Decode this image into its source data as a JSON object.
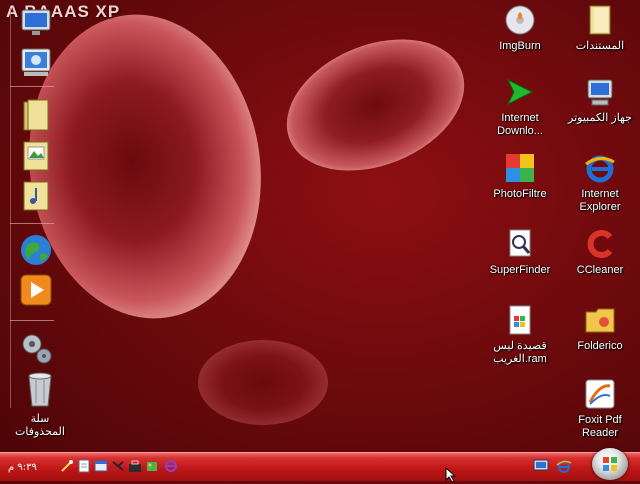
{
  "desktop": {
    "brand": "A    BAAAS XP",
    "recycle_bin": {
      "label": "سلة المحذوفات",
      "icon": "recycle-bin-icon"
    },
    "icons": [
      {
        "label": "المستندات",
        "icon": "my-documents-folder-icon"
      },
      {
        "label": "ImgBurn",
        "icon": "imgburn-disc-icon"
      },
      {
        "label": "جهاز الكمبيوتر",
        "icon": "my-computer-icon"
      },
      {
        "label": "Internet\nDownlo...",
        "icon": "internet-download-manager-icon"
      },
      {
        "label": "Internet\nExplorer",
        "icon": "internet-explorer-icon"
      },
      {
        "label": "PhotoFiltre",
        "icon": "photofiltre-icon"
      },
      {
        "label": "CCleaner",
        "icon": "ccleaner-icon"
      },
      {
        "label": "SuperFinder",
        "icon": "superfinder-icon"
      },
      {
        "label": "Folderico",
        "icon": "folderico-icon"
      },
      {
        "label": "قصيدة ليس\nالغريب.ram",
        "icon": "ram-media-file-icon"
      },
      {
        "label": "Foxit Pdf\nReader",
        "icon": "foxit-reader-icon"
      }
    ]
  },
  "sidebar": {
    "items": [
      {
        "icon": "computer-monitor-icon"
      },
      {
        "icon": "control-panel-icon"
      },
      {
        "icon": "folder-icon"
      },
      {
        "icon": "pictures-folder-icon"
      },
      {
        "icon": "music-folder-icon"
      },
      {
        "icon": "globe-icon"
      },
      {
        "icon": "media-player-icon"
      },
      {
        "icon": "settings-gears-icon"
      }
    ]
  },
  "taskbar": {
    "clock": "٩:٣٩ م",
    "quick_launch": [
      "magic-wand-icon",
      "notepad-icon",
      "explorer-window-icon",
      "network-icon",
      "toolbox-icon",
      "paint-icon",
      "ie-shortcut-icon"
    ],
    "tray": [
      "monitor-tray-icon",
      "ie-tray-icon"
    ],
    "start_button": "start-orb-icon"
  },
  "colors": {
    "taskbar": "#c01818",
    "background": "#6e0a0d",
    "label_text": "#ffffff"
  }
}
